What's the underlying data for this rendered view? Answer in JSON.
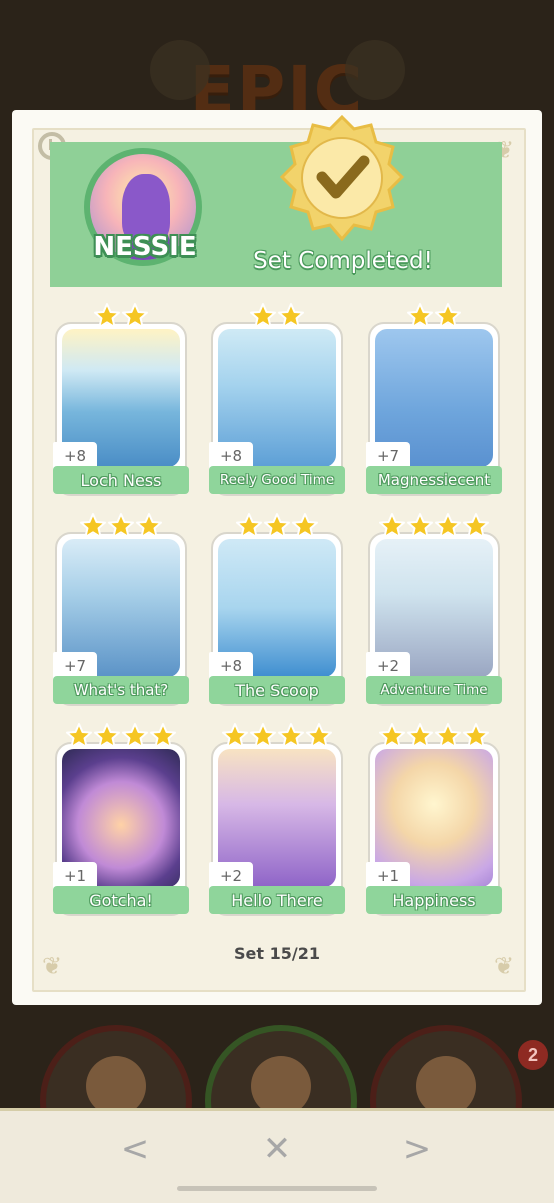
{
  "background": {
    "title": "EPIC",
    "badge_count": "2"
  },
  "header": {
    "set_name": "NESSIE",
    "status": "Set Completed!"
  },
  "cards": [
    {
      "name": "Loch Ness",
      "count": "+8",
      "stars": 2
    },
    {
      "name": "Reely Good Time",
      "count": "+8",
      "stars": 2
    },
    {
      "name": "Magnessiecent",
      "count": "+7",
      "stars": 2
    },
    {
      "name": "What's that?",
      "count": "+7",
      "stars": 3
    },
    {
      "name": "The Scoop",
      "count": "+8",
      "stars": 3
    },
    {
      "name": "Adventure Time",
      "count": "+2",
      "stars": 4
    },
    {
      "name": "Gotcha!",
      "count": "+1",
      "stars": 4
    },
    {
      "name": "Hello There",
      "count": "+2",
      "stars": 4
    },
    {
      "name": "Happiness",
      "count": "+1",
      "stars": 4
    }
  ],
  "footer": {
    "set_count": "Set 15/21"
  },
  "nav": {
    "prev": "<",
    "close": "✕",
    "next": ">"
  },
  "colors": {
    "header_green": "#8fd097",
    "label_green": "#8fd59b",
    "star_gold": "#f5c623",
    "seal_gold": "#f2d36b"
  }
}
